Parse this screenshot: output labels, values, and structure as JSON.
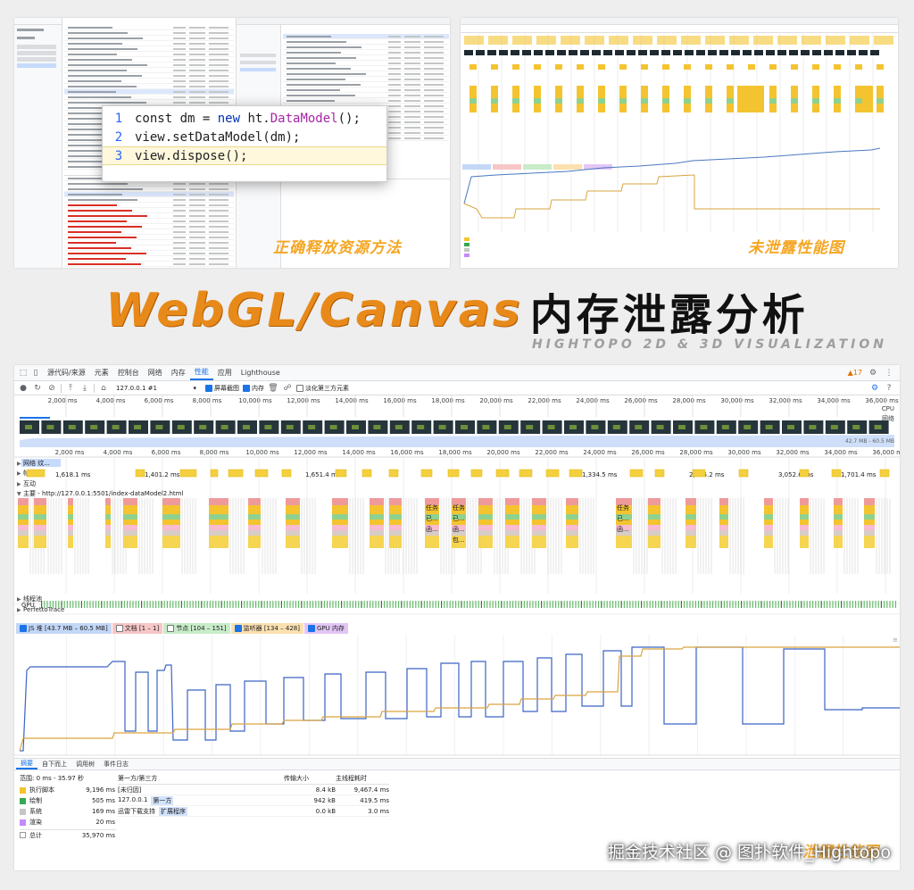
{
  "top_left": {
    "code_lines": [
      {
        "num": "1",
        "pre": "const dm = ",
        "kw": "new",
        "mid": " ht.",
        "cls": "DataModel",
        "post": "();"
      },
      {
        "num": "2",
        "pre": "view.setDataModel(dm);",
        "kw": "",
        "mid": "",
        "cls": "",
        "post": ""
      },
      {
        "num": "3",
        "pre": "view.dispose();",
        "kw": "",
        "mid": "",
        "cls": "",
        "post": ""
      }
    ],
    "caption": "正确释放资源方法"
  },
  "top_right": {
    "caption": "未泄露性能图"
  },
  "banner": {
    "title_en": "WebGL/Canvas",
    "title_zh": "内存泄露分析",
    "subtitle": "HIGHTOPO 2D & 3D VISUALIZATION"
  },
  "devtools": {
    "tabs": [
      "源代码/来源",
      "元素",
      "控制台",
      "网络",
      "内存",
      "性能",
      "应用",
      "Lighthouse"
    ],
    "active_tab": "性能",
    "warning_count": "17",
    "toolbar": {
      "url_select": "127.0.0.1 #1",
      "screenshot_label": "屏幕截图",
      "memory_label": "内存",
      "third_party_label": "淡化第三方元素"
    },
    "ruler_ticks": [
      "2,000 ms",
      "4,000 ms",
      "6,000 ms",
      "8,000 ms",
      "10,000 ms",
      "12,000 ms",
      "14,000 ms",
      "16,000 ms",
      "18,000 ms",
      "20,000 ms",
      "22,000 ms",
      "24,000 ms",
      "26,000 ms",
      "28,000 ms",
      "30,000 ms",
      "32,000 ms",
      "34,000 ms",
      "36,000 ms"
    ],
    "overview_labels": {
      "cpu": "CPU",
      "net": "网络",
      "heap": "42.7 MB - 60.5 MB"
    },
    "tracks": {
      "network": "网络 纹...",
      "frames": "帧",
      "interactions": "互动",
      "main": "主要 - http://127.0.0.1:5501/index-dataModel2.html",
      "thread_pool": "线程池",
      "perfetto": "PerfettoTrace",
      "gpu": "GPU"
    },
    "frame_times": [
      "1,618.1 ms",
      "1,401.2 ms",
      "1,651.4 ms",
      "1,334.5 ms",
      "2,585.2 ms",
      "3,052.6 ms",
      "1,701.4 ms"
    ],
    "main_task_labels": [
      "任务",
      "已...",
      "函...",
      "任务",
      "已...",
      "函...",
      "包...",
      "任务",
      "已...",
      "函..."
    ],
    "memory_legend": [
      {
        "label": "JS 堆 [43.7 MB – 60.5 MB]",
        "color": "#c3d7f7",
        "checked": true
      },
      {
        "label": "文档 [1 – 1]",
        "color": "#f7c6c6",
        "checked": false
      },
      {
        "label": "节点 [104 – 151]",
        "color": "#c8ecc8",
        "checked": false
      },
      {
        "label": "监听器 [134 – 428]",
        "color": "#fbe0b0",
        "checked": true
      },
      {
        "label": "GPU 内存",
        "color": "#e3c6f5",
        "checked": true
      }
    ],
    "bottom_tabs": [
      "摘要",
      "自下而上",
      "调用树",
      "事件日志"
    ],
    "summary": {
      "range": "范围: 0 ms - 35.97 秒",
      "rows": [
        {
          "name": "执行脚本",
          "value": "9,196 ms",
          "color": "#f4c430"
        },
        {
          "name": "绘制",
          "value": "505 ms",
          "color": "#34a853"
        },
        {
          "name": "系统",
          "value": "169 ms",
          "color": "#c4c7c5"
        },
        {
          "name": "渲染",
          "value": "20 ms",
          "color": "#c58af9"
        },
        {
          "name": "总计",
          "value": "35,970 ms",
          "color": ""
        }
      ]
    },
    "third_party": {
      "headers": [
        "第一方/第三方",
        "传输大小",
        "主线程耗时"
      ],
      "rows": [
        {
          "name": "[未归因]",
          "tag": "",
          "size": "8.4 kB",
          "time": "9,467.4 ms"
        },
        {
          "name": "127.0.0.1",
          "tag": "第一方",
          "size": "942 kB",
          "time": "419.5 ms"
        },
        {
          "name": "迅雷下载支持",
          "tag": "扩展程序",
          "size": "0.0 kB",
          "time": "3.0 ms"
        }
      ]
    }
  },
  "watermark": {
    "text": "掘金技术社区 @ 图扑软件_Hightopo",
    "orange_text": "泄露性能图"
  }
}
